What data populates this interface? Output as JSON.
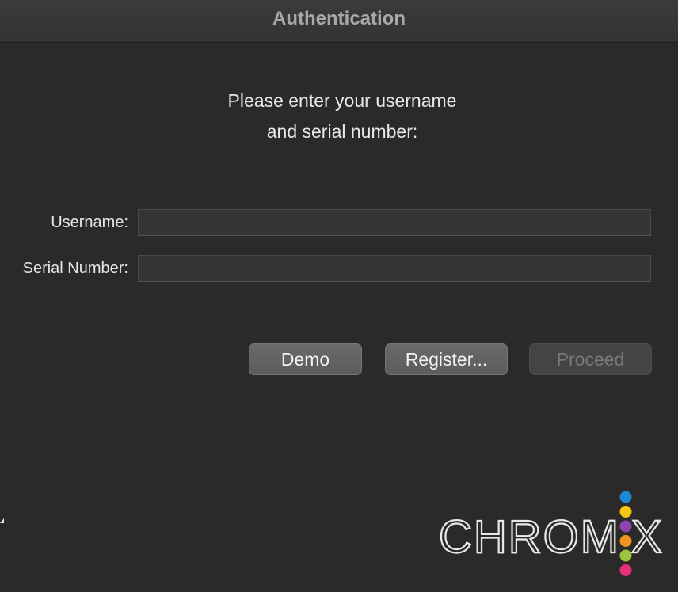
{
  "window": {
    "title": "Authentication"
  },
  "prompt": {
    "line1": "Please enter your username",
    "line2": "and serial number:"
  },
  "form": {
    "username_label": "Username:",
    "username_value": "",
    "serial_label": "Serial Number:",
    "serial_value": ""
  },
  "buttons": {
    "demo": "Demo",
    "register": "Register...",
    "proceed": "Proceed",
    "proceed_enabled": false
  },
  "logo": {
    "text": "CHROMIX",
    "dot_colors": [
      "#1e88d6",
      "#f6c415",
      "#8e44ad",
      "#f39322",
      "#9bc53d",
      "#e6317a"
    ]
  }
}
